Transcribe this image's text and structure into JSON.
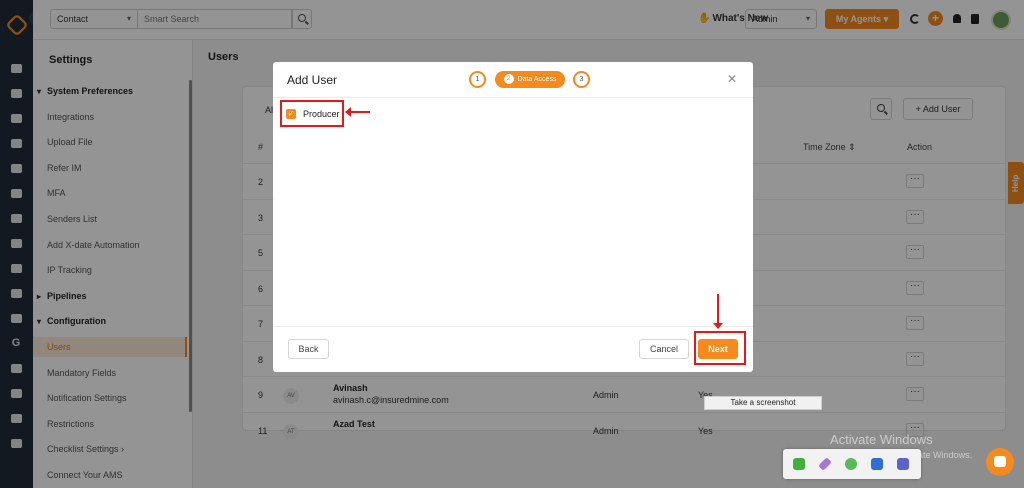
{
  "topbar": {
    "context_select": "Contact",
    "search_placeholder": "Smart Search",
    "whats_new": "What's New",
    "role_select": "Admin",
    "my_agents": "My Agents"
  },
  "settings": {
    "title": "Settings",
    "items": [
      {
        "label": "System Preferences",
        "type": "section",
        "caret": "▾"
      },
      {
        "label": "Integrations",
        "type": "item"
      },
      {
        "label": "Upload File",
        "type": "item"
      },
      {
        "label": "Refer IM",
        "type": "item"
      },
      {
        "label": "MFA",
        "type": "item"
      },
      {
        "label": "Senders List",
        "type": "item"
      },
      {
        "label": "Add X-date Automation",
        "type": "item"
      },
      {
        "label": "IP Tracking",
        "type": "item"
      },
      {
        "label": "Pipelines",
        "type": "section",
        "caret": "▸"
      },
      {
        "label": "Configuration",
        "type": "section",
        "caret": "▾"
      },
      {
        "label": "Users",
        "type": "item",
        "active": true
      },
      {
        "label": "Mandatory Fields",
        "type": "item"
      },
      {
        "label": "Notification Settings",
        "type": "item"
      },
      {
        "label": "Restrictions",
        "type": "item"
      },
      {
        "label": "Checklist Settings  ›",
        "type": "item"
      },
      {
        "label": "Connect Your AMS",
        "type": "item"
      }
    ]
  },
  "main": {
    "title": "Users",
    "filter_partial": "All",
    "add_user": "+ Add User",
    "headers": {
      "num": "#",
      "timezone": "Time Zone ⇕",
      "action": "Action"
    },
    "rows": [
      {
        "num": "2"
      },
      {
        "num": "3"
      },
      {
        "num": "5"
      },
      {
        "num": "6"
      },
      {
        "num": "7"
      },
      {
        "num": "8"
      },
      {
        "num": "9",
        "initials": "AV",
        "name": "Avinash",
        "email": "avinash.c@insuredmine.com",
        "role": "Admin",
        "flag": "Yes"
      },
      {
        "num": "11",
        "initials": "AT",
        "name": "Azad Test",
        "email": "",
        "role": "Admin",
        "flag": "Yes"
      }
    ],
    "row_action": "···"
  },
  "help_tab": "Help",
  "modal": {
    "title": "Add User",
    "steps": [
      {
        "num": "1"
      },
      {
        "num": "2",
        "label": "Data Access"
      },
      {
        "num": "3"
      }
    ],
    "checkbox_label": "Producer",
    "checkbox_checked": true,
    "back": "Back",
    "cancel": "Cancel",
    "next": "Next"
  },
  "tooltip": "Take a screenshot",
  "watermark": {
    "line1": "Activate Windows",
    "line2": "Go to Settings to activate Windows."
  },
  "colors": {
    "accent": "#f58a1f",
    "annotation": "#e01b1b",
    "rail": "#1f2b3a"
  }
}
